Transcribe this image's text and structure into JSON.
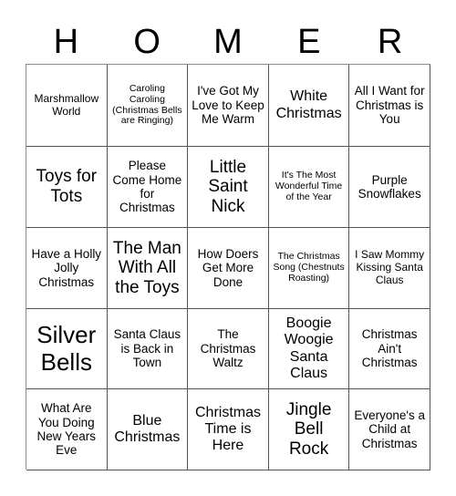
{
  "card": {
    "title_letters": [
      "H",
      "O",
      "M",
      "E",
      "R"
    ],
    "grid": {
      "rows": 5,
      "columns": 5,
      "cells": [
        {
          "text": "Marshmallow World",
          "size": "fs-s"
        },
        {
          "text": "Caroling Caroling (Christmas Bells are Ringing)",
          "size": "fs-xs"
        },
        {
          "text": "I've Got My Love to Keep Me Warm",
          "size": "fs-m"
        },
        {
          "text": "White Christmas",
          "size": "fs-l"
        },
        {
          "text": "All I Want for Christmas is You",
          "size": "fs-m"
        },
        {
          "text": "Toys for Tots",
          "size": "fs-xl"
        },
        {
          "text": "Please Come Home for Christmas",
          "size": "fs-m"
        },
        {
          "text": "Little Saint Nick",
          "size": "fs-xl"
        },
        {
          "text": "It's The Most Wonderful Time of the Year",
          "size": "fs-xs"
        },
        {
          "text": "Purple Snowflakes",
          "size": "fs-m"
        },
        {
          "text": "Have a Holly Jolly Christmas",
          "size": "fs-m"
        },
        {
          "text": "The Man With All the Toys",
          "size": "fs-xl"
        },
        {
          "text": "How Doers Get More Done",
          "size": "fs-m"
        },
        {
          "text": "The Christmas Song (Chestnuts Roasting)",
          "size": "fs-xs"
        },
        {
          "text": "I Saw Mommy Kissing Santa Claus",
          "size": "fs-s"
        },
        {
          "text": "Silver Bells",
          "size": "fs-xxl"
        },
        {
          "text": "Santa Claus is Back in Town",
          "size": "fs-m"
        },
        {
          "text": "The Christmas Waltz",
          "size": "fs-m"
        },
        {
          "text": "Boogie Woogie Santa Claus",
          "size": "fs-l"
        },
        {
          "text": "Christmas Ain't Christmas",
          "size": "fs-m"
        },
        {
          "text": "What Are You Doing New Years Eve",
          "size": "fs-m"
        },
        {
          "text": "Blue Christmas",
          "size": "fs-l"
        },
        {
          "text": "Christmas Time is Here",
          "size": "fs-l"
        },
        {
          "text": "Jingle Bell Rock",
          "size": "fs-xl"
        },
        {
          "text": "Everyone's a Child at Christmas",
          "size": "fs-m"
        }
      ]
    },
    "colors": {
      "background": "#ffffff",
      "text": "#000000",
      "grid_line": "#545454"
    }
  }
}
